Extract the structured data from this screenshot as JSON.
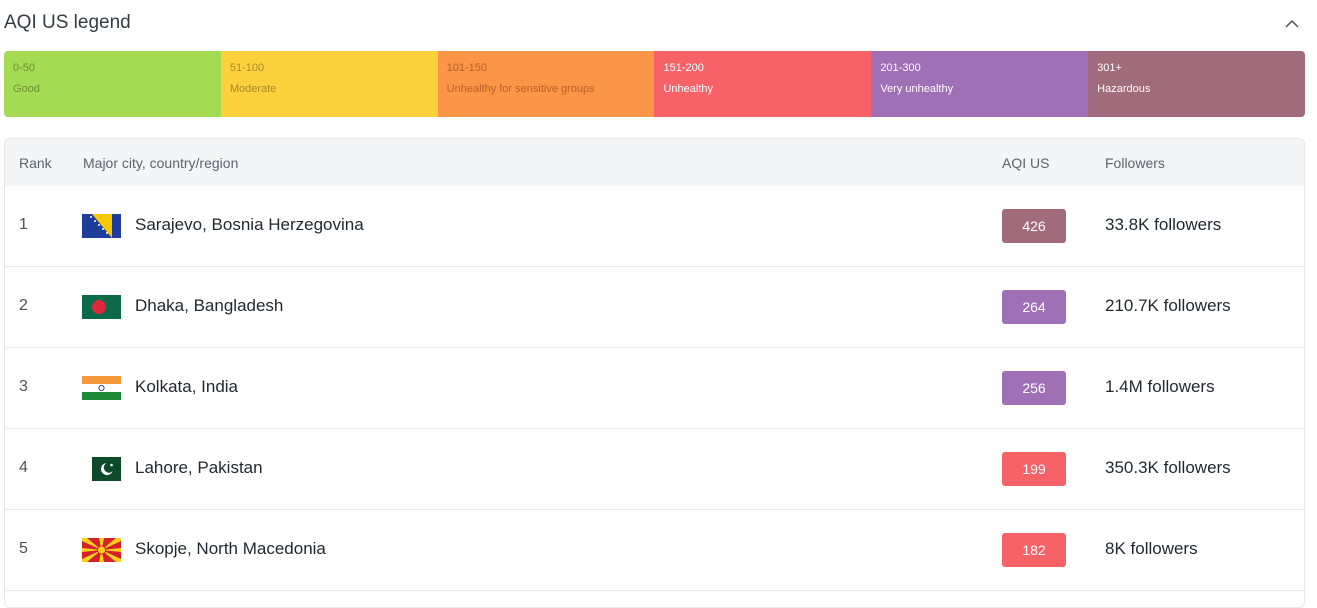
{
  "legend": {
    "title": "AQI US legend",
    "collapse_icon": "chevron-up-icon",
    "segments": [
      {
        "range": "0-50",
        "label": "Good",
        "bg": "#a3db52",
        "fg": "#6f8f39"
      },
      {
        "range": "51-100",
        "label": "Moderate",
        "bg": "#fcd13c",
        "fg": "#a98a2a"
      },
      {
        "range": "101-150",
        "label": "Unhealthy for sensitive groups",
        "bg": "#fb9547",
        "fg": "#b8612a"
      },
      {
        "range": "151-200",
        "label": "Unhealthy",
        "bg": "#f66267",
        "fg": "#ffffff"
      },
      {
        "range": "201-300",
        "label": "Very unhealthy",
        "bg": "#a070b6",
        "fg": "#ffffff"
      },
      {
        "range": "301+",
        "label": "Hazardous",
        "bg": "#a06b7b",
        "fg": "#ffffff"
      }
    ]
  },
  "table": {
    "headers": {
      "rank": "Rank",
      "city": "Major city, country/region",
      "aqi": "AQI US",
      "followers": "Followers"
    },
    "rows": [
      {
        "rank": "1",
        "city": "Sarajevo, Bosnia Herzegovina",
        "flag": "bosnia-herzegovina-flag-icon",
        "aqi": "426",
        "aqi_color": "#a06b7b",
        "followers": "33.8K followers"
      },
      {
        "rank": "2",
        "city": "Dhaka, Bangladesh",
        "flag": "bangladesh-flag-icon",
        "aqi": "264",
        "aqi_color": "#a070b6",
        "followers": "210.7K followers"
      },
      {
        "rank": "3",
        "city": "Kolkata, India",
        "flag": "india-flag-icon",
        "aqi": "256",
        "aqi_color": "#a070b6",
        "followers": "1.4M followers"
      },
      {
        "rank": "4",
        "city": "Lahore, Pakistan",
        "flag": "pakistan-flag-icon",
        "aqi": "199",
        "aqi_color": "#f66267",
        "followers": "350.3K followers"
      },
      {
        "rank": "5",
        "city": "Skopje, North Macedonia",
        "flag": "north-macedonia-flag-icon",
        "aqi": "182",
        "aqi_color": "#f66267",
        "followers": "8K followers"
      }
    ]
  }
}
